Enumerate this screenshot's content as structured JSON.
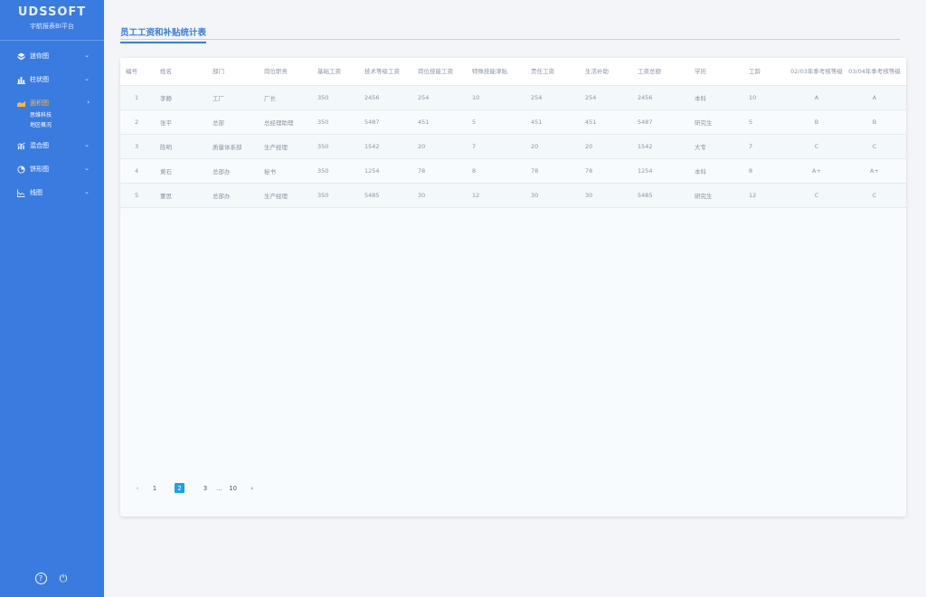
{
  "brand": {
    "logo": "UDSSOFT",
    "subtitle": "宇航报表BI平台"
  },
  "sidebar": {
    "items": [
      {
        "label": "迷你图",
        "icon": "cube-icon",
        "chevron": "⌄"
      },
      {
        "label": "柱状图",
        "icon": "bar-chart-icon",
        "chevron": "⌄"
      },
      {
        "label": "面积图",
        "icon": "area-chart-icon",
        "chevron": "›",
        "active": true,
        "children": [
          "思维科技",
          "地区概况"
        ]
      },
      {
        "label": "混合图",
        "icon": "mixed-chart-icon",
        "chevron": "⌄"
      },
      {
        "label": "饼形图",
        "icon": "pie-chart-icon",
        "chevron": "⌄"
      },
      {
        "label": "线图",
        "icon": "line-chart-icon",
        "chevron": "⌄"
      }
    ],
    "bottom": {
      "help": "?",
      "power": "⏻"
    }
  },
  "page": {
    "title": "员工工资和补贴统计表"
  },
  "table": {
    "headers": [
      "编号",
      "姓名",
      "部门",
      "岗位职务",
      "基础工资",
      "技术等级工资",
      "岗位技能工资",
      "特殊技能津贴",
      "责任工资",
      "生活补助",
      "工资总额",
      "学历",
      "工龄",
      "02/03年季考核等级",
      "03/04年季考核等级"
    ],
    "rows": [
      [
        "1",
        "李静",
        "工厂",
        "厂长",
        "350",
        "2456",
        "254",
        "10",
        "254",
        "254",
        "2456",
        "本科",
        "10",
        "A",
        "A"
      ],
      [
        "2",
        "张平",
        "总部",
        "总经理助理",
        "350",
        "5487",
        "451",
        "5",
        "451",
        "451",
        "5487",
        "研究生",
        "5",
        "B",
        "B"
      ],
      [
        "3",
        "陈明",
        "质量体系部",
        "生产经理",
        "350",
        "1542",
        "20",
        "7",
        "20",
        "20",
        "1542",
        "大专",
        "7",
        "C",
        "C"
      ],
      [
        "4",
        "黄石",
        "总部办",
        "秘书",
        "350",
        "1254",
        "78",
        "8",
        "78",
        "78",
        "1254",
        "本科",
        "8",
        "A+",
        "A+"
      ],
      [
        "5",
        "董思",
        "总部办",
        "生产经理",
        "350",
        "5485",
        "30",
        "12",
        "30",
        "30",
        "5485",
        "研究生",
        "12",
        "C",
        "C"
      ]
    ]
  },
  "pagination": {
    "prev": "‹",
    "pages": [
      "1",
      "2",
      "3"
    ],
    "active": "2",
    "ellipsis": "...",
    "last": "10",
    "next": "›"
  },
  "colors": {
    "sidebar": "#3a7be0",
    "accent": "#3a7be0",
    "active_nav": "#ffb63b",
    "pager_active": "#1da0e6"
  }
}
